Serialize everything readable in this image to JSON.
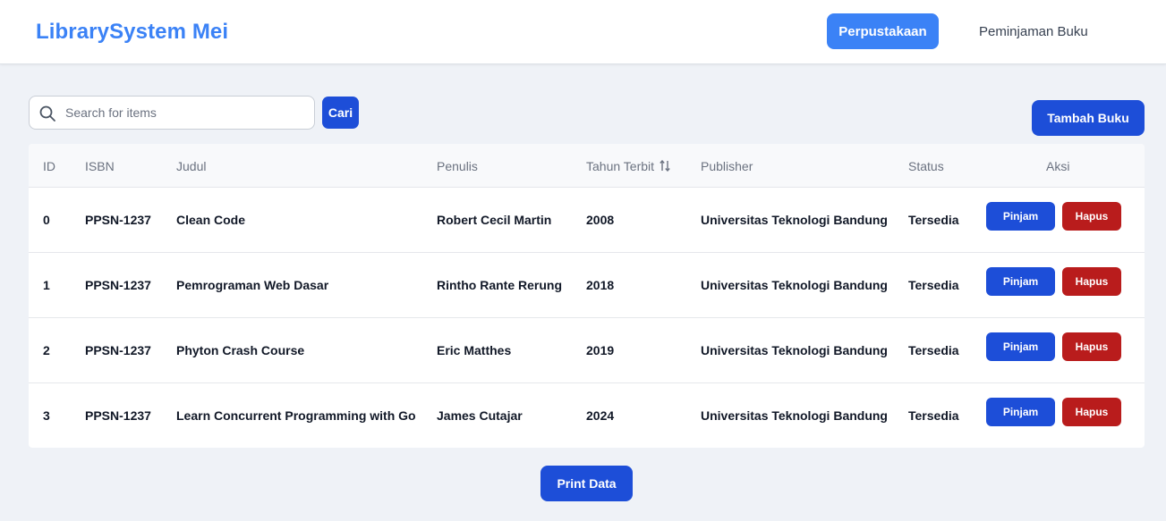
{
  "navbar": {
    "brand": "LibrarySystem Mei",
    "active_item": "Perpustakaan",
    "link_item": "Peminjaman Buku"
  },
  "search": {
    "placeholder": "Search for items",
    "value": "",
    "button_label": "Cari"
  },
  "toolbar": {
    "add_label": "Tambah Buku"
  },
  "table": {
    "headers": [
      "ID",
      "ISBN",
      "Judul",
      "Penulis",
      "Tahun Terbit",
      "Publisher",
      "Status",
      "Aksi"
    ],
    "rows": [
      {
        "id": "0",
        "isbn": "PPSN-1237",
        "judul": "Clean Code",
        "penulis": "Robert Cecil Martin",
        "tahun": "2008",
        "publisher": "Universitas Teknologi Bandung",
        "status": "Tersedia"
      },
      {
        "id": "1",
        "isbn": "PPSN-1237",
        "judul": "Pemrograman Web Dasar",
        "penulis": "Rintho Rante Rerung",
        "tahun": "2018",
        "publisher": "Universitas Teknologi Bandung",
        "status": "Tersedia"
      },
      {
        "id": "2",
        "isbn": "PPSN-1237",
        "judul": "Phyton Crash Course",
        "penulis": "Eric Matthes",
        "tahun": "2019",
        "publisher": "Universitas Teknologi Bandung",
        "status": "Tersedia"
      },
      {
        "id": "3",
        "isbn": "PPSN-1237",
        "judul": "Learn Concurrent Programming with Go",
        "penulis": "James Cutajar",
        "tahun": "2024",
        "publisher": "Universitas Teknologi Bandung",
        "status": "Tersedia"
      }
    ],
    "borrow_label": "Pinjam",
    "delete_label": "Hapus"
  },
  "footer": {
    "print_label": "Print Data"
  },
  "icons": {
    "search": "search-icon",
    "sort": "sort-icon"
  },
  "colors": {
    "brand": "#3b82f6",
    "primary": "#1d4ed8",
    "danger": "#b91c1c",
    "background": "#eff2f7"
  }
}
